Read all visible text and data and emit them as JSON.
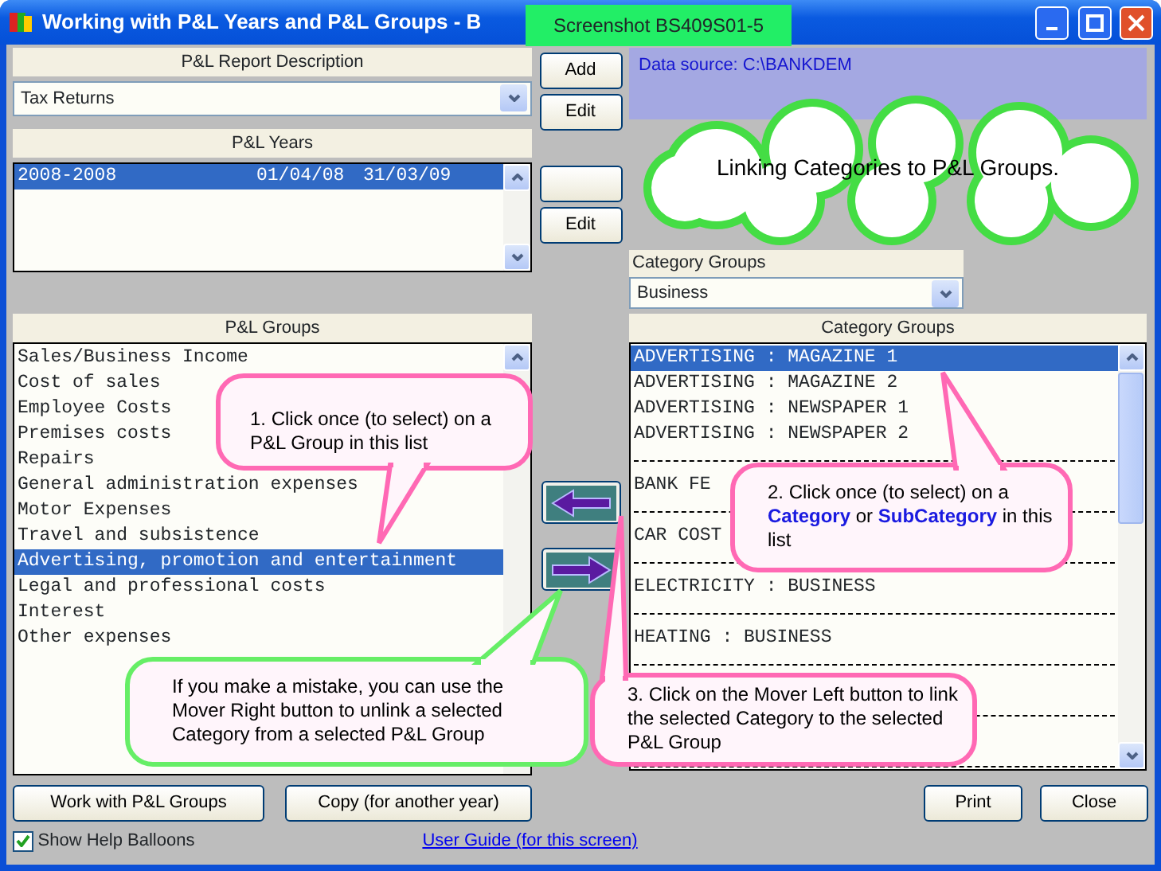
{
  "window": {
    "title": "Working with P&L Years and P&L Groups - B"
  },
  "screenshot_label": "Screenshot BS409S01-5",
  "report_description": {
    "header": "P&L Report Description",
    "value": "Tax Returns"
  },
  "years": {
    "header": "P&L Years",
    "rows": [
      {
        "name": "2008-2008",
        "start": "01/04/08",
        "end": "31/03/09",
        "selected": true
      }
    ]
  },
  "side_buttons": [
    {
      "kind": "text",
      "text": "Add"
    },
    {
      "kind": "text",
      "text": "Edit"
    },
    {
      "kind": "blank"
    },
    {
      "kind": "text",
      "text": "Edit"
    }
  ],
  "data_source": "Data source: C:\\BANKDEM",
  "groups": {
    "header": "P&L Groups",
    "rows": [
      {
        "text": "Sales/Business Income",
        "selected": false
      },
      {
        "text": "Cost of sales",
        "selected": false
      },
      {
        "text": "Employee Costs",
        "selected": false
      },
      {
        "text": "Premises costs",
        "selected": false
      },
      {
        "text": "Repairs",
        "selected": false
      },
      {
        "text": "General administration expenses",
        "selected": false
      },
      {
        "text": "Motor Expenses",
        "selected": false
      },
      {
        "text": "Travel and subsistence",
        "selected": false
      },
      {
        "text": "Advertising, promotion and entertainment",
        "selected": true
      },
      {
        "text": "Legal and professional costs",
        "selected": false
      },
      {
        "text": "Interest",
        "selected": false
      },
      {
        "text": "Other expenses",
        "selected": false
      }
    ]
  },
  "category_groups": {
    "label": "Category Groups",
    "value": "Business",
    "header": "Category Groups",
    "rows": [
      {
        "kind": "item",
        "text": "ADVERTISING : MAGAZINE 1",
        "selected": true
      },
      {
        "kind": "item",
        "text": "ADVERTISING : MAGAZINE 2",
        "selected": false
      },
      {
        "kind": "item",
        "text": "ADVERTISING : NEWSPAPER 1",
        "selected": false
      },
      {
        "kind": "item",
        "text": "ADVERTISING : NEWSPAPER 2",
        "selected": false
      },
      {
        "kind": "separator"
      },
      {
        "kind": "item",
        "text": "BANK FE",
        "selected": false
      },
      {
        "kind": "separator"
      },
      {
        "kind": "item",
        "text": "CAR COST",
        "selected": false
      },
      {
        "kind": "separator"
      },
      {
        "kind": "item",
        "text": "ELECTRICITY : BUSINESS",
        "selected": false
      },
      {
        "kind": "separator"
      },
      {
        "kind": "item",
        "text": "HEATING : BUSINESS",
        "selected": false
      },
      {
        "kind": "separator"
      },
      {
        "kind": "gap"
      },
      {
        "kind": "separator"
      },
      {
        "kind": "gap"
      },
      {
        "kind": "separator"
      }
    ]
  },
  "cloud": "Linking Categories to P&L Groups.",
  "balloons": [
    {
      "color": "#ff69b4",
      "text": "1. Click once (to select) on a P&L Group in this list"
    },
    {
      "color": "#ff69b4",
      "text": "2. Click once (to select) on a **Category** or **SubCategory** in this list"
    },
    {
      "color": "#66ee66",
      "text": "If you make a mistake, you can use the Mover Right button to unlink a selected Category from a selected P&L Group"
    },
    {
      "color": "#ff69b4",
      "text": "3. Click on the Mover Left button to link the selected Category to the selected P&L Group"
    }
  ],
  "bottom_buttons": [
    "Work with P&L Groups",
    "Copy (for another year)",
    "Print",
    "Close"
  ],
  "show_help": {
    "label": "Show Help Balloons",
    "checked": true
  },
  "user_guide": "User Guide (for this screen)"
}
